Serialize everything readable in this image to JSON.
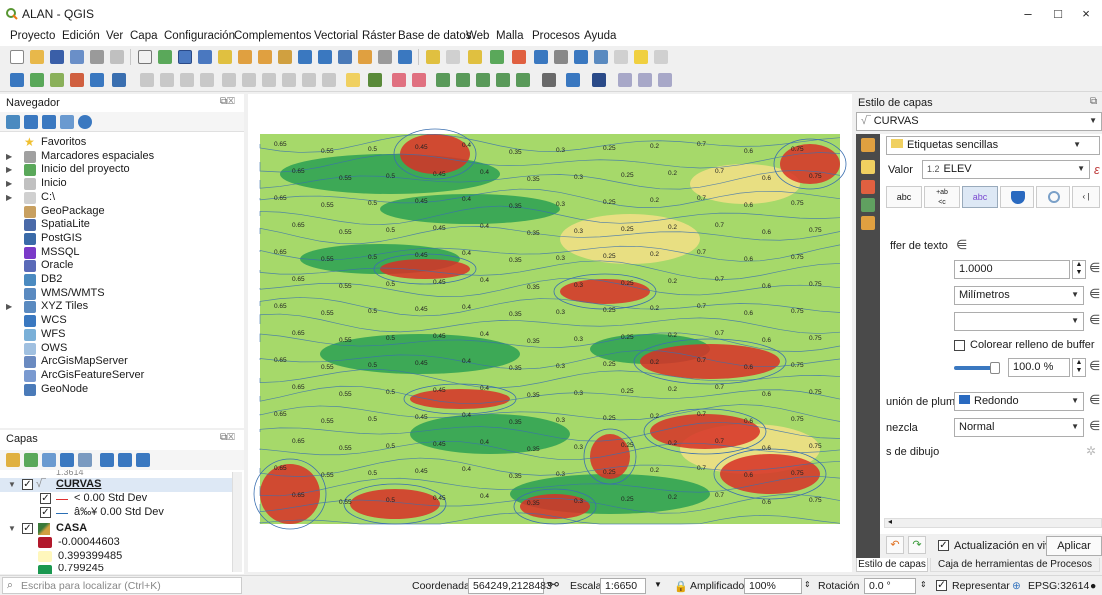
{
  "window": {
    "title": "ALAN - QGIS",
    "controls": [
      "–",
      "□",
      "×"
    ]
  },
  "menu": [
    "Proyecto",
    "Edición",
    "Ver",
    "Capa",
    "Configuración",
    "Complementos",
    "Vectorial",
    "Ráster",
    "Base de datos",
    "Web",
    "Malla",
    "Procesos",
    "Ayuda"
  ],
  "browser": {
    "title": "Navegador",
    "items": [
      {
        "label": "Favoritos",
        "icon": "star-icon"
      },
      {
        "label": "Marcadores espaciales",
        "icon": "bookmarks-icon"
      },
      {
        "label": "Inicio del proyecto",
        "icon": "project-home-icon"
      },
      {
        "label": "Inicio",
        "icon": "home-folder-icon"
      },
      {
        "label": "C:\\",
        "icon": "drive-icon"
      },
      {
        "label": "GeoPackage",
        "icon": "geopackage-icon"
      },
      {
        "label": "SpatiaLite",
        "icon": "spatialite-icon"
      },
      {
        "label": "PostGIS",
        "icon": "postgis-icon"
      },
      {
        "label": "MSSQL",
        "icon": "mssql-icon"
      },
      {
        "label": "Oracle",
        "icon": "oracle-icon"
      },
      {
        "label": "DB2",
        "icon": "db2-icon"
      },
      {
        "label": "WMS/WMTS",
        "icon": "wms-icon"
      },
      {
        "label": "XYZ Tiles",
        "icon": "xyz-tiles-icon"
      },
      {
        "label": "WCS",
        "icon": "wcs-icon"
      },
      {
        "label": "WFS",
        "icon": "wfs-icon"
      },
      {
        "label": "OWS",
        "icon": "ows-icon"
      },
      {
        "label": "ArcGisMapServer",
        "icon": "arcgis-mapserver-icon"
      },
      {
        "label": "ArcGisFeatureServer",
        "icon": "arcgis-featureserver-icon"
      },
      {
        "label": "GeoNode",
        "icon": "geonode-icon"
      }
    ]
  },
  "layers": {
    "title": "Capas",
    "clipped_text": "1.3614",
    "items": [
      {
        "label": "CURVAS",
        "checked": true
      },
      {
        "label": "< 0.00 Std Dev",
        "checked": true
      },
      {
        "label": "â‰¥ 0.00 Std Dev",
        "checked": true
      },
      {
        "label": "CASA",
        "checked": true
      },
      {
        "label": "-0.00044603"
      },
      {
        "label": "0.399399485"
      },
      {
        "label": "0.799245"
      }
    ],
    "colors": {
      "a": "#b2182b",
      "b": "#fff7bc",
      "c": "#1a9850",
      "line_a": "#e03030",
      "line_b": "#2b6fb5"
    }
  },
  "styling": {
    "title": "Estilo de capas",
    "layer": "CURVAS",
    "mode": "Etiquetas sencillas",
    "value_prefix": "Valor",
    "value_field_type": "1.2",
    "value_field": "ELEV",
    "tab_abc": "abc",
    "tab_ab_c": "+ab\n<c",
    "tab_abc_active": "abc",
    "section_buffer": "ffer de texto",
    "buffer_size": "1.0000",
    "buffer_unit": "Milímetros",
    "color_fill_label": "Colorear relleno de buffer",
    "opacity": "100.0 %",
    "pen_join_label": "unión de plumilla",
    "pen_join_value": "Redondo",
    "blend_label": "nezcla",
    "blend_value": "Normal",
    "effects_label": "s de dibujo",
    "live_update_label": "Actualización en vivo",
    "apply_label": "Aplicar",
    "tabs": [
      "Estilo de capas",
      "Caja de herramientas de Procesos"
    ]
  },
  "status": {
    "search_placeholder": "Escriba para localizar (Ctrl+K)",
    "coord_label": "Coordenada",
    "coord_value": "564249,2128483",
    "scale_label": "Escala",
    "scale_value": "1:6650",
    "magnifier_label": "Amplificador",
    "magnifier_value": "100%",
    "rotation_label": "Rotación",
    "rotation_value": "0.0 °",
    "render_label": "Representar",
    "crs": "EPSG:32614"
  },
  "map": {
    "contour_labels": [
      "0.65",
      "0.55",
      "0.5",
      "0.45",
      "0.4",
      "0.35",
      "0.3",
      "0.25",
      "0.2",
      "0.7",
      "0.6",
      "0.75"
    ],
    "colors": {
      "low": "#1a9850",
      "mid": "#a6d96a",
      "high": "#fee08b",
      "peak": "#d73027",
      "contour": "#3a6fb0"
    }
  }
}
